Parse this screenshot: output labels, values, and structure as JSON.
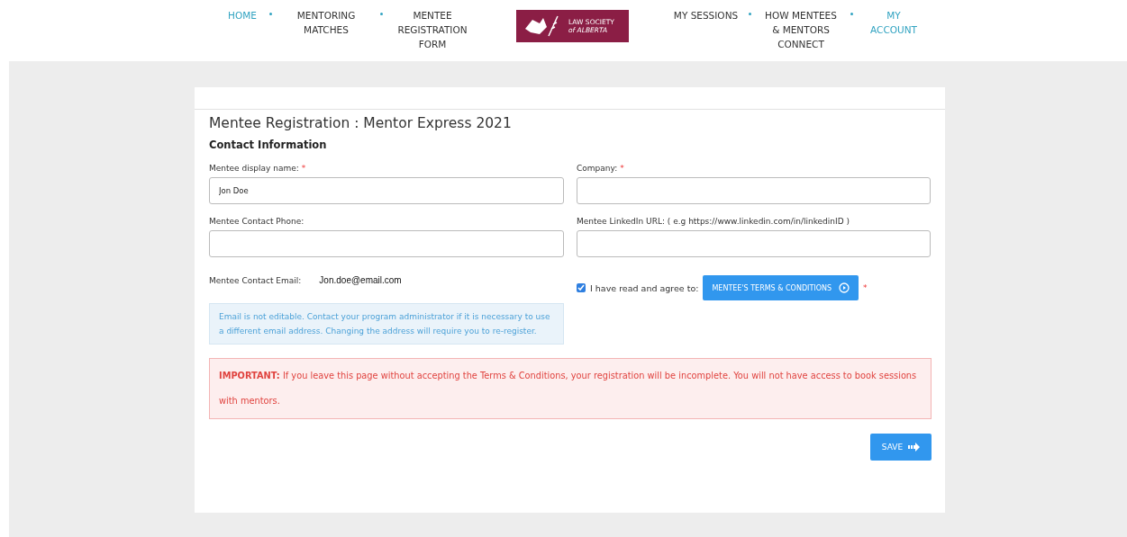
{
  "nav": {
    "left": [
      {
        "label": "HOME",
        "selected": true
      },
      {
        "label": "MENTORING MATCHES",
        "selected": false
      },
      {
        "label": "MENTEE REGISTRATION FORM",
        "selected": false
      }
    ],
    "logo": {
      "line_1": "LAW SOCIETY",
      "line_2": "of ALBERTA"
    },
    "right": [
      {
        "label": "MY SESSIONS",
        "selected": false
      },
      {
        "label": "HOW MENTEES & MENTORS CONNECT",
        "selected": false
      },
      {
        "label": "MY ACCOUNT",
        "selected": true
      }
    ]
  },
  "form": {
    "title": "Mentee Registration : Mentor Express 2021",
    "section": "Contact Information",
    "fields": [
      {
        "label": "Mentee display name:",
        "required_mark": "*",
        "value": "Jon Doe"
      },
      {
        "label": "Company:",
        "required_mark": "*"
      },
      {
        "label": "Mentee Contact Phone:"
      },
      {
        "label": "Mentee LinkedIn URL: ( e.g https://www.linkedin.com/in/linkedinID )"
      }
    ],
    "email": {
      "label": "Mentee Contact Email:",
      "value": "Jon.doe@email.com"
    },
    "email_note": "Email is not editable. Contact your program administrator if it is necessary to use a different email address. Changing the address will require you to re-register.",
    "agree": {
      "label": "I have read and agree to:",
      "checked": true,
      "button": "MENTEE'S TERMS & CONDITIONS",
      "required_mark": "*"
    },
    "warning": "**IMPORTANT:** If you leave this page without accepting the Terms & Conditions, your registration will be incomplete. You will not have access to book sessions with mentors.",
    "save": "SAVE"
  }
}
